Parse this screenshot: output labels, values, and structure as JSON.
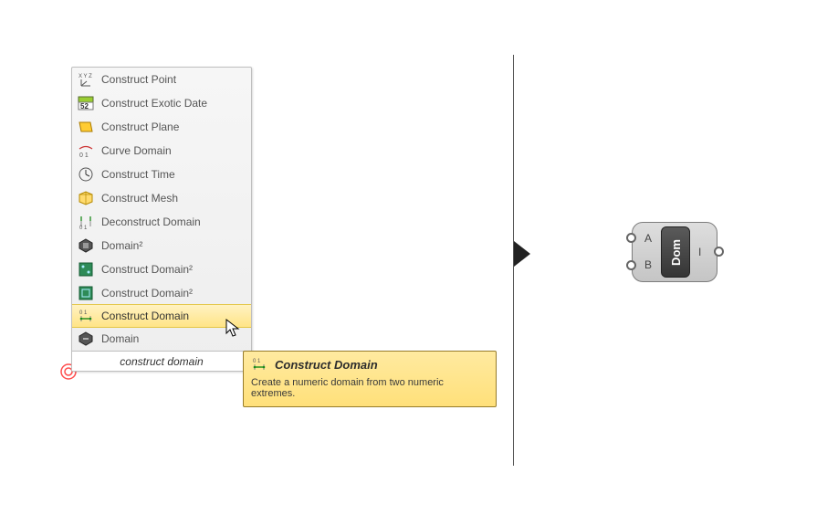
{
  "menu": {
    "items": [
      {
        "label": "Construct Point",
        "icon": "xyz-icon"
      },
      {
        "label": "Construct Exotic Date",
        "icon": "calendar-icon"
      },
      {
        "label": "Construct Plane",
        "icon": "plane-icon"
      },
      {
        "label": "Curve Domain",
        "icon": "curve-domain-icon"
      },
      {
        "label": "Construct Time",
        "icon": "clock-icon"
      },
      {
        "label": "Construct Mesh",
        "icon": "mesh-icon"
      },
      {
        "label": "Deconstruct Domain",
        "icon": "deconstruct-domain-icon"
      },
      {
        "label": "Domain²",
        "icon": "domain2-hex-icon"
      },
      {
        "label": "Construct Domain²",
        "icon": "domain2-green-icon"
      },
      {
        "label": "Construct Domain²",
        "icon": "domain2-green2-icon"
      },
      {
        "label": "Construct Domain",
        "icon": "construct-domain-icon",
        "selected": true
      },
      {
        "label": "Domain",
        "icon": "domain-hex-icon"
      }
    ],
    "search_text": "construct domain"
  },
  "tooltip": {
    "title": "Construct Domain",
    "body": "Create a numeric domain from two numeric extremes.",
    "icon": "construct-domain-icon"
  },
  "component": {
    "name": "Dom",
    "inputs": [
      "A",
      "B"
    ],
    "outputs": [
      "I"
    ]
  }
}
